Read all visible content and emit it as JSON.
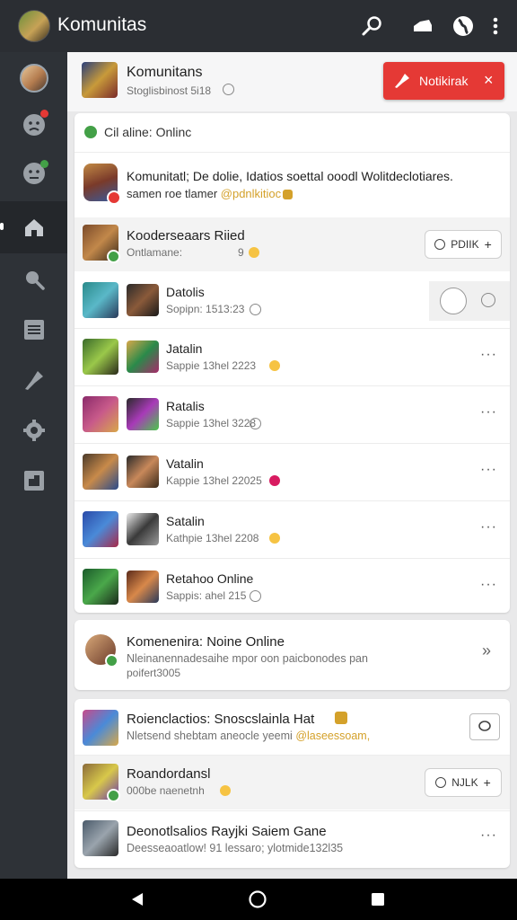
{
  "app": {
    "title": "Komunitas"
  },
  "topbar": {
    "icons": [
      "search-icon",
      "announce-icon",
      "globe-icon",
      "more-vert-icon"
    ]
  },
  "sidebar": {
    "icons": [
      "profile-avatar",
      "chat-icon",
      "emoji-icon",
      "home-icon",
      "search-icon",
      "list-icon",
      "pin-icon",
      "settings-icon",
      "puzzle-icon"
    ]
  },
  "header": {
    "title": "Komunitans",
    "subtitle": "Stoglisbinost 5i18",
    "notif_label": "Notikirak",
    "close_symbol": "×"
  },
  "online": {
    "label": "Cil aline: Onlinc"
  },
  "featured": {
    "title": "Komunitatl; De dolie, Idatios soettal ooodl Wolitdeclotiares.",
    "line2_plain": "samen roe tlamer ",
    "line2_highlight": "@pdnlkitioc"
  },
  "highlight_row": {
    "title": "Kooderseaars Riied",
    "subtitle": "Ontlamane:",
    "extra": "9",
    "pill_label": "PDIIK"
  },
  "members": [
    {
      "name": "Datolis",
      "meta": "Sopipn: 1513:23"
    },
    {
      "name": "Jatalin",
      "meta": "Sappie 13hel 2223"
    },
    {
      "name": "Ratalis",
      "meta": "Sappie 13hel 3228"
    },
    {
      "name": "Vatalin",
      "meta": "Kappie 13hel 22025"
    },
    {
      "name": "Satalin",
      "meta": "Kathpie 13hel 2208"
    },
    {
      "name": "Retahoo Online",
      "meta": "Sappis: ahel 215"
    }
  ],
  "online_card": {
    "title": "Komenenira: Noine Online",
    "desc_line1": "Nleinanennadesaihe mpor oon paicbonodes pan",
    "desc_line2": "poifert3005"
  },
  "posts": [
    {
      "title": "Roienclactios: Snoscslainla Hat",
      "desc": "Nletsend shebtam aneocle yeemi ",
      "desc_highlight": "@laseessoam,"
    },
    {
      "title": "Roandordansl",
      "desc": "000be naenetnh",
      "pill_label": "NJLK"
    },
    {
      "title": "Deonotlsalios Rayjki Saiem Gane",
      "desc": "Deesseaoatlow! 91 lessaro; ylotmide132l35"
    }
  ],
  "colors": {
    "accent_red": "#e53935",
    "online_green": "#43a047",
    "topbar": "#2b2e33",
    "sidebar": "#2e3237",
    "highlight_text": "#d4a12a"
  },
  "navbar": {
    "buttons": [
      "back-icon",
      "home-circle-icon",
      "recents-icon"
    ]
  }
}
